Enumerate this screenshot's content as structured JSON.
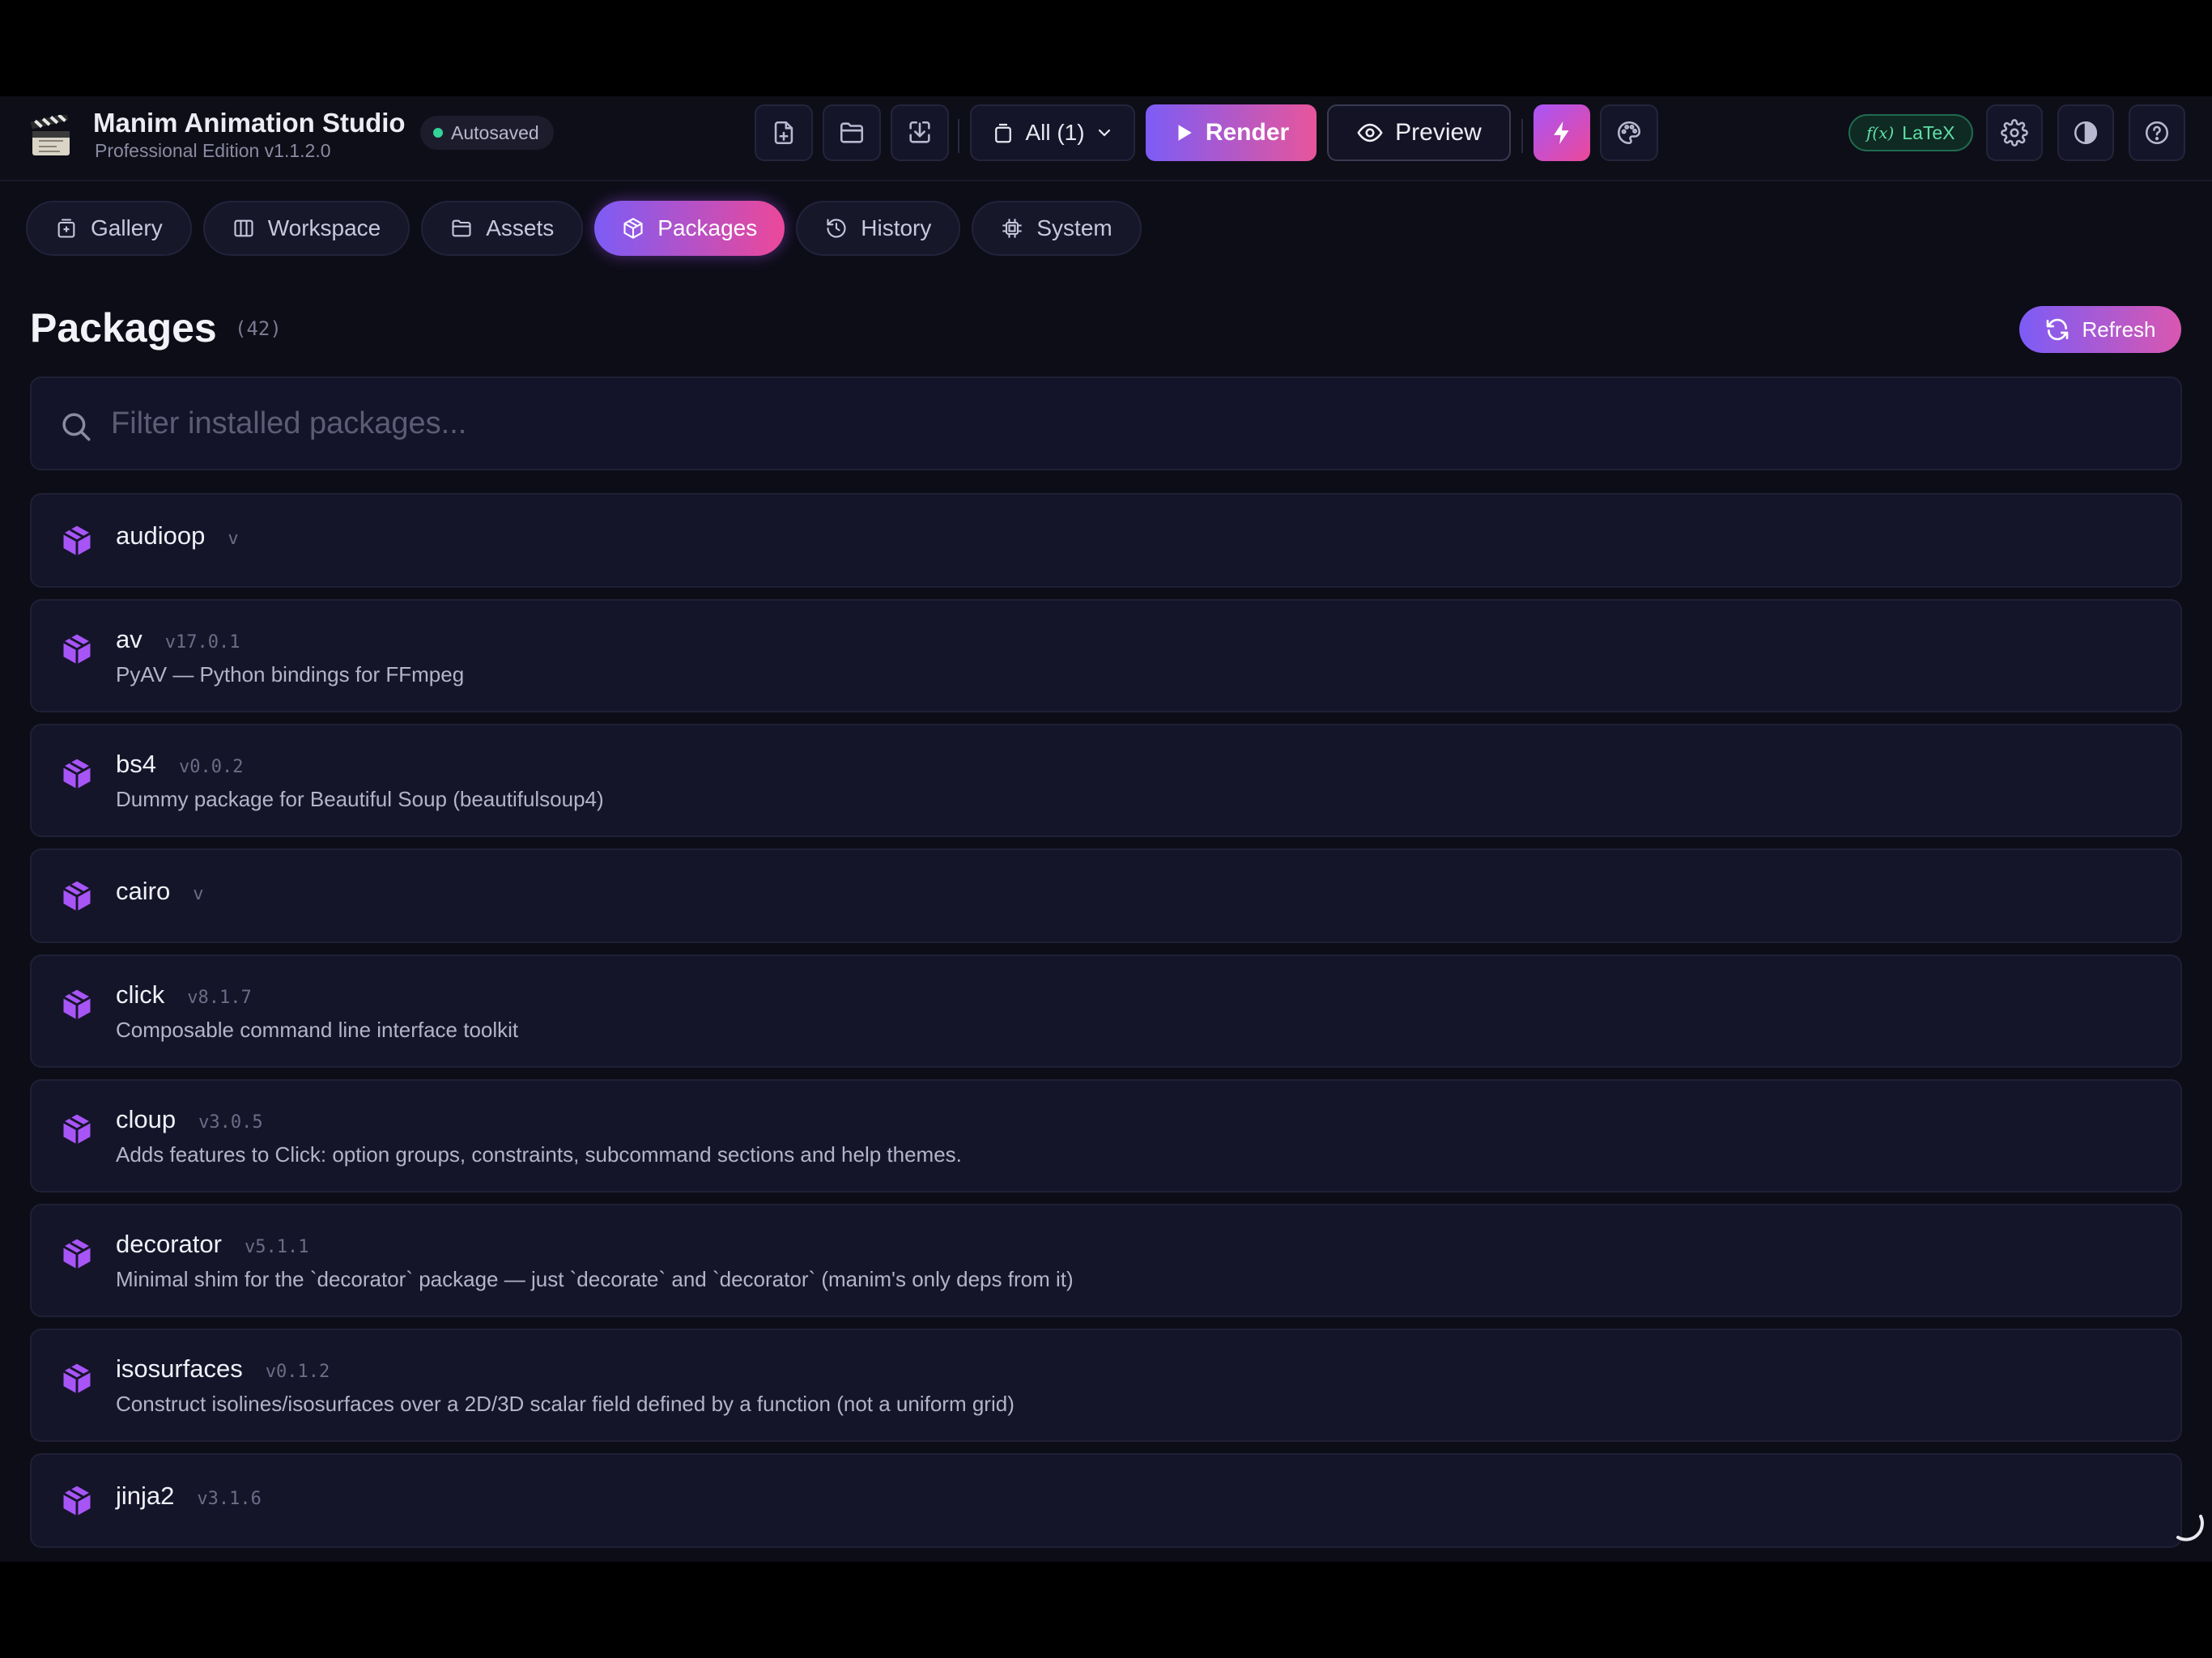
{
  "app": {
    "title": "Manim Animation Studio",
    "subtitle": "Professional Edition v1.1.2.0",
    "autosave": "Autosaved"
  },
  "toolbar": {
    "scene_select": "All (1)",
    "render": "Render",
    "preview": "Preview",
    "latex": "LaTeX",
    "latex_fx": "f(x)"
  },
  "tabs": [
    {
      "label": "Gallery",
      "icon": "gallery-icon",
      "active": false
    },
    {
      "label": "Workspace",
      "icon": "columns-icon",
      "active": false
    },
    {
      "label": "Assets",
      "icon": "folder-icon",
      "active": false
    },
    {
      "label": "Packages",
      "icon": "package-icon",
      "active": true
    },
    {
      "label": "History",
      "icon": "history-icon",
      "active": false
    },
    {
      "label": "System",
      "icon": "chip-icon",
      "active": false
    }
  ],
  "section": {
    "title": "Packages",
    "count": "(42)",
    "refresh": "Refresh"
  },
  "search": {
    "placeholder": "Filter installed packages..."
  },
  "packages": [
    {
      "name": "audioop",
      "version": "v",
      "description": ""
    },
    {
      "name": "av",
      "version": "v17.0.1",
      "description": "PyAV — Python bindings for FFmpeg"
    },
    {
      "name": "bs4",
      "version": "v0.0.2",
      "description": "Dummy package for Beautiful Soup (beautifulsoup4)"
    },
    {
      "name": "cairo",
      "version": "v",
      "description": ""
    },
    {
      "name": "click",
      "version": "v8.1.7",
      "description": "Composable command line interface toolkit"
    },
    {
      "name": "cloup",
      "version": "v3.0.5",
      "description": "Adds features to Click: option groups, constraints, subcommand sections and help themes."
    },
    {
      "name": "decorator",
      "version": "v5.1.1",
      "description": "Minimal shim for the `decorator` package — just `decorate` and `decorator` (manim's only deps from it)"
    },
    {
      "name": "isosurfaces",
      "version": "v0.1.2",
      "description": "Construct isolines/isosurfaces over a 2D/3D scalar field defined by a function (not a uniform grid)"
    },
    {
      "name": "jinja2",
      "version": "v3.1.6",
      "description": ""
    }
  ],
  "colors": {
    "accent_start": "#7c5cf6",
    "accent_end": "#ec4899",
    "cube": "#a855f7",
    "status_ok": "#34d399"
  }
}
